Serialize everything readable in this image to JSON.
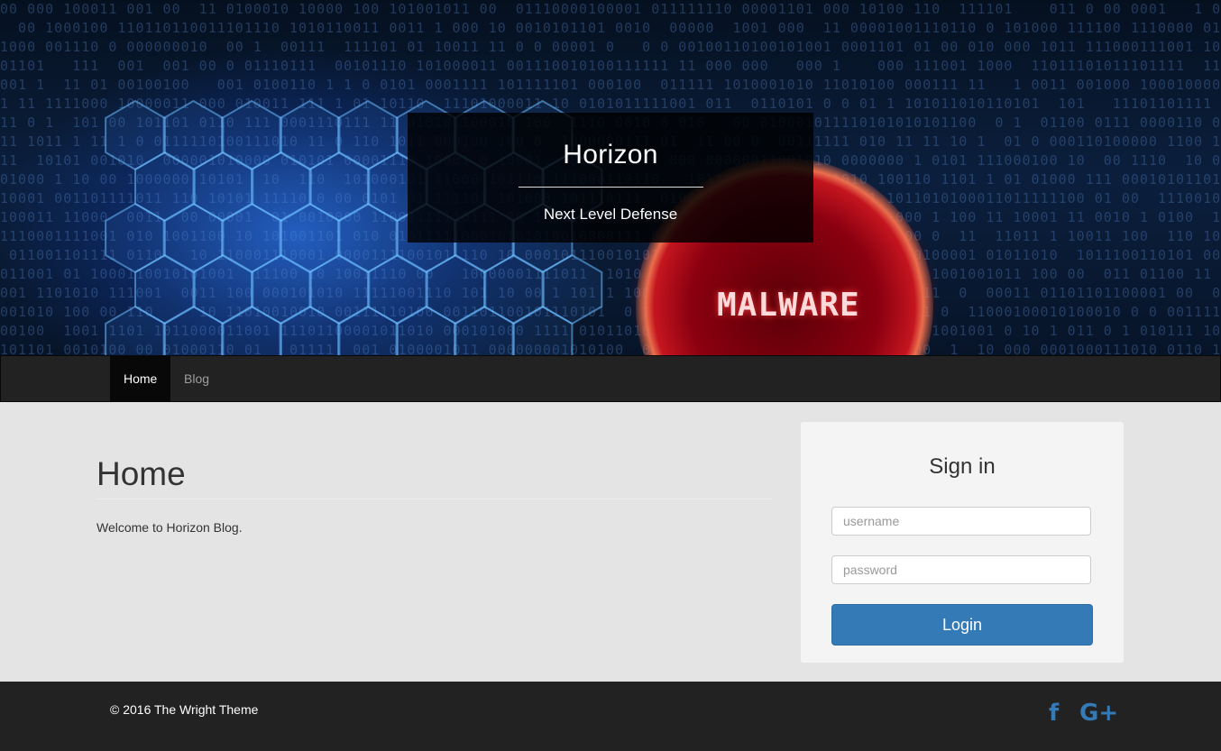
{
  "hero": {
    "title": "Horizon",
    "tagline": "Next Level Defense",
    "banner_text": "MALWARE"
  },
  "nav": {
    "items": [
      {
        "label": "Home",
        "active": true
      },
      {
        "label": "Blog",
        "active": false
      }
    ]
  },
  "main": {
    "heading": "Home",
    "text": "Welcome to Horizon Blog."
  },
  "signin": {
    "title": "Sign in",
    "username_placeholder": "username",
    "password_placeholder": "password",
    "login_label": "Login"
  },
  "footer": {
    "copyright": "© 2016 The Wright Theme",
    "social": [
      {
        "icon": "facebook-icon",
        "glyph": "f"
      },
      {
        "icon": "google-plus-icon",
        "glyph": "G+"
      }
    ]
  },
  "colors": {
    "accent": "#337ab7",
    "navbar": "#222222",
    "footer": "#222222",
    "content_bg": "#e4e4e4"
  }
}
